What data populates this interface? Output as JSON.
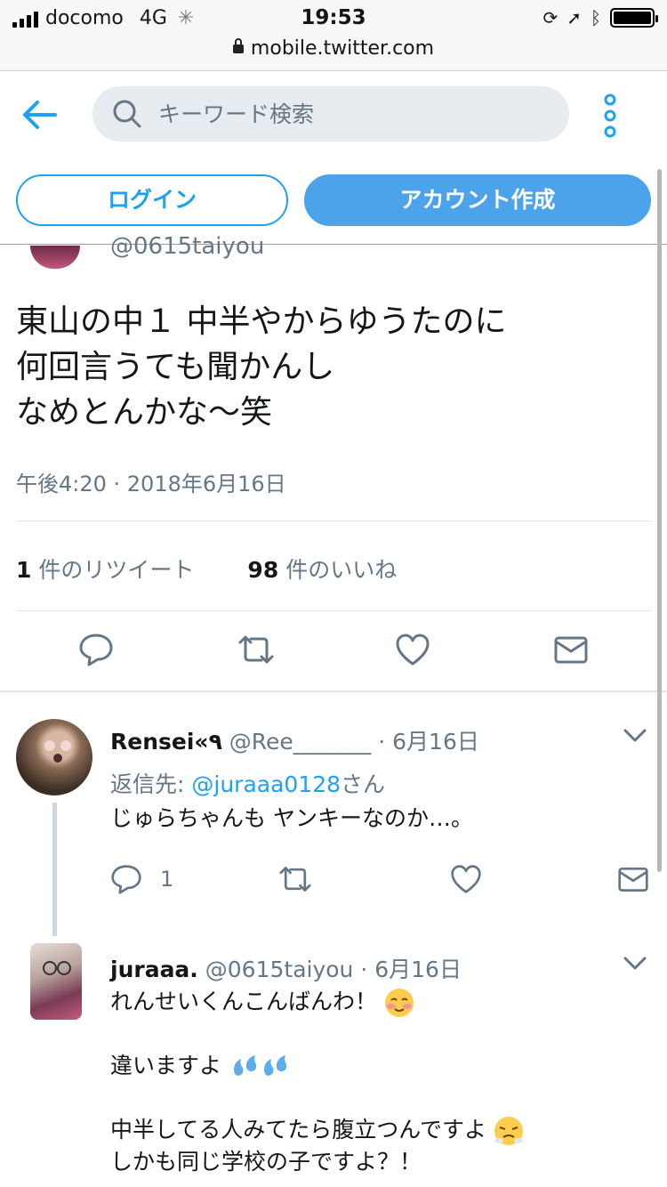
{
  "status": {
    "carrier": "docomo",
    "network": "4G",
    "time": "19:53"
  },
  "url": "mobile.twitter.com",
  "search": {
    "placeholder": "キーワード検索"
  },
  "buttons": {
    "login": "ログイン",
    "signup": "アカウント作成"
  },
  "tweet": {
    "prev_handle": "@0615taiyou",
    "text": "東山の中１ 中半やからゆうたのに\n何回言うても聞かんし\nなめとんかな〜笑",
    "time": "午後4:20 · 2018年6月16日",
    "retweets": {
      "count": "1",
      "label": "件のリツイート"
    },
    "likes": {
      "count": "98",
      "label": "件のいいね"
    }
  },
  "replies": [
    {
      "name": "Rensei«٩",
      "handle": "@Ree_______",
      "date": " · 6月16日",
      "reply_to_prefix": "返信先: ",
      "reply_to_user": "@juraaa0128",
      "reply_to_suffix": "さん",
      "text": "じゅらちゃんも ヤンキーなのか…。",
      "reply_count": "1"
    },
    {
      "name": "juraaa.",
      "handle": "@0615taiyou",
      "date": " · 6月16日",
      "line1": "れんせいくんこんばんわ！",
      "line2": "違いますよ",
      "line3": "中半してる人みてたら腹立つんですよ",
      "line4": "しかも同じ学校の子ですよ？！"
    }
  ],
  "icons": {
    "emoji1": "blushing-face-icon",
    "emoji2": "sweat-droplets-icon",
    "emoji3": "steam-from-nose-face-icon"
  },
  "colors": {
    "accent": "#1da1f2",
    "signup_bg": "#4ca3ea",
    "secondary_text": "#657786"
  }
}
